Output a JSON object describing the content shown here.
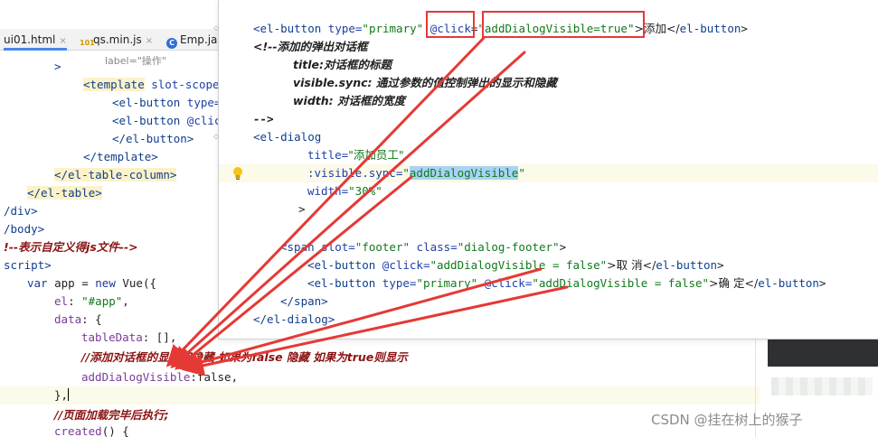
{
  "editor": {
    "tabs": [
      {
        "label": "ui01.html",
        "close": "×",
        "icon": ""
      },
      {
        "label": "qs.min.js",
        "close": "×",
        "icon": "101"
      },
      {
        "label": "Emp.ja",
        "close": "",
        "icon": "C"
      }
    ],
    "background_lines": {
      "l1": "label=\"操作\"",
      "l2_a": ">",
      "l3_tag": "<template",
      "l3_attr": " slot-scope",
      "l4_tag": "<el-button",
      "l4_attr": " type=",
      "l5_tag": "<el-button",
      "l5_attr": " @clic",
      "l6": "</el-button>",
      "l7": "</template>",
      "l8": "</el-table-column>",
      "l9": "</el-table>",
      "l10": "/div>",
      "l11": "/body>",
      "l12": "!--表示自定义得js文件-->",
      "l13": "script>",
      "l14_kw": "var",
      "l14_rest": " app = ",
      "l14_kw2": "new",
      "l14_rest2": " Vue({",
      "l15_key": "el",
      "l15_val": "\"#app\"",
      "l16_key": "data",
      "l16_rest": ": {",
      "l17_key": "tableData",
      "l17_rest": ": [],",
      "l18": "//添加对话框的显示和隐藏 如果为false 隐藏 如果为true则显示",
      "l19_key": "addDialogVisible",
      "l19_rest": ":false,",
      "l20": "},",
      "l21": "//页面加载完毕后执行;",
      "l22_key": "created",
      "l22_rest": "() {"
    },
    "watermark": "CSDN @挂在树上的猴子"
  },
  "overlay": {
    "lines": {
      "o1_tag": "<el-button",
      "o1_attr1": " type=",
      "o1_val1": "\"primary\"",
      "o1_click": "@click",
      "o1_eq": "=",
      "o1_val2": "\"addDialogVisible=true\"",
      "o1_text": ">添加</",
      "o1_tag2": "el-button",
      "o1_end": ">",
      "o2": "<!--添加的弹出对话框",
      "o3": "title:对话框的标题",
      "o4": "visible.sync: 通过参数的值控制弹出的显示和隐藏",
      "o5": "width: 对话框的宽度",
      "o6": "-->",
      "o7": "<el-dialog",
      "o8_attr": "title=",
      "o8_val": "\"添加员工\"",
      "o9_attr": ":visible.sync=",
      "o9_q1": "\"",
      "o9_sel": "addDialogVisible",
      "o9_q2": "\"",
      "o10_attr": "width=",
      "o10_val": "\"30%\"",
      "o11": ">",
      "o12_tag": "<span",
      "o12_attr1": " slot=",
      "o12_val1": "\"footer\"",
      "o12_attr2": " class=",
      "o12_val2": "\"dialog-footer\"",
      "o12_end": ">",
      "o13_tag": "<el-button",
      "o13_attr": " @click=",
      "o13_val": "\"addDialogVisible = false\"",
      "o13_text": ">取 消</",
      "o13_tag2": "el-button",
      "o13_end": ">",
      "o14_tag": "<el-button",
      "o14_attr1": " type=",
      "o14_val1": "\"primary\"",
      "o14_attr2": " @click=",
      "o14_val2": "\"addDialogVisible = false\"",
      "o14_text": ">确 定</",
      "o14_tag2": "el-button",
      "o14_end": ">",
      "o15": "</span>",
      "o16": "</el-dialog>"
    }
  },
  "colors": {
    "annotation_red": "#e53935",
    "selection_blue": "#a9d3f5",
    "current_line": "#fcfae8",
    "tag_blue": "#0f3e8f",
    "string_green": "#10791a",
    "comment_red": "#8a1313"
  },
  "icons": [
    "close-icon",
    "js-file-icon",
    "java-class-icon",
    "lightbulb-icon",
    "fold-icon"
  ]
}
